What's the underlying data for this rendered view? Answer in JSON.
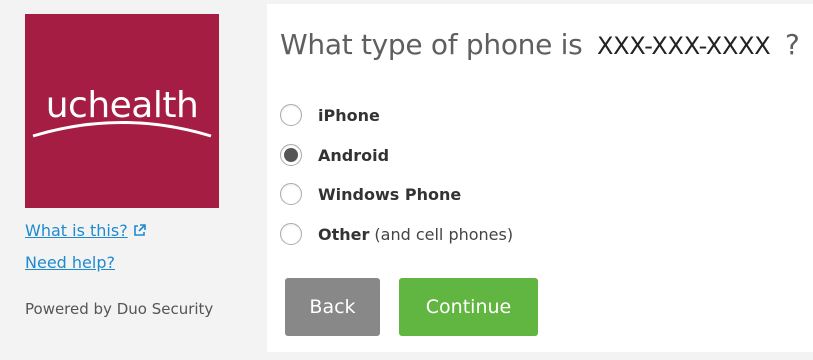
{
  "sidebar": {
    "logo_text": "uchealth",
    "what_is_this": "What is this?",
    "need_help": "Need help?",
    "powered_by": "Powered by Duo Security"
  },
  "prompt": {
    "question_prefix": "What type of phone is",
    "phone_number": "XXX-XXX-XXXX",
    "question_suffix": "?"
  },
  "options": [
    {
      "label": "iPhone",
      "sub": "",
      "selected": false
    },
    {
      "label": "Android",
      "sub": "",
      "selected": true
    },
    {
      "label": "Windows Phone",
      "sub": "",
      "selected": false
    },
    {
      "label": "Other",
      "sub": "(and cell phones)",
      "selected": false
    }
  ],
  "buttons": {
    "back": "Back",
    "continue": "Continue"
  },
  "colors": {
    "brand": "#a51d43",
    "link": "#1e8bcf",
    "back_button": "#888888",
    "continue_button": "#61b641"
  }
}
